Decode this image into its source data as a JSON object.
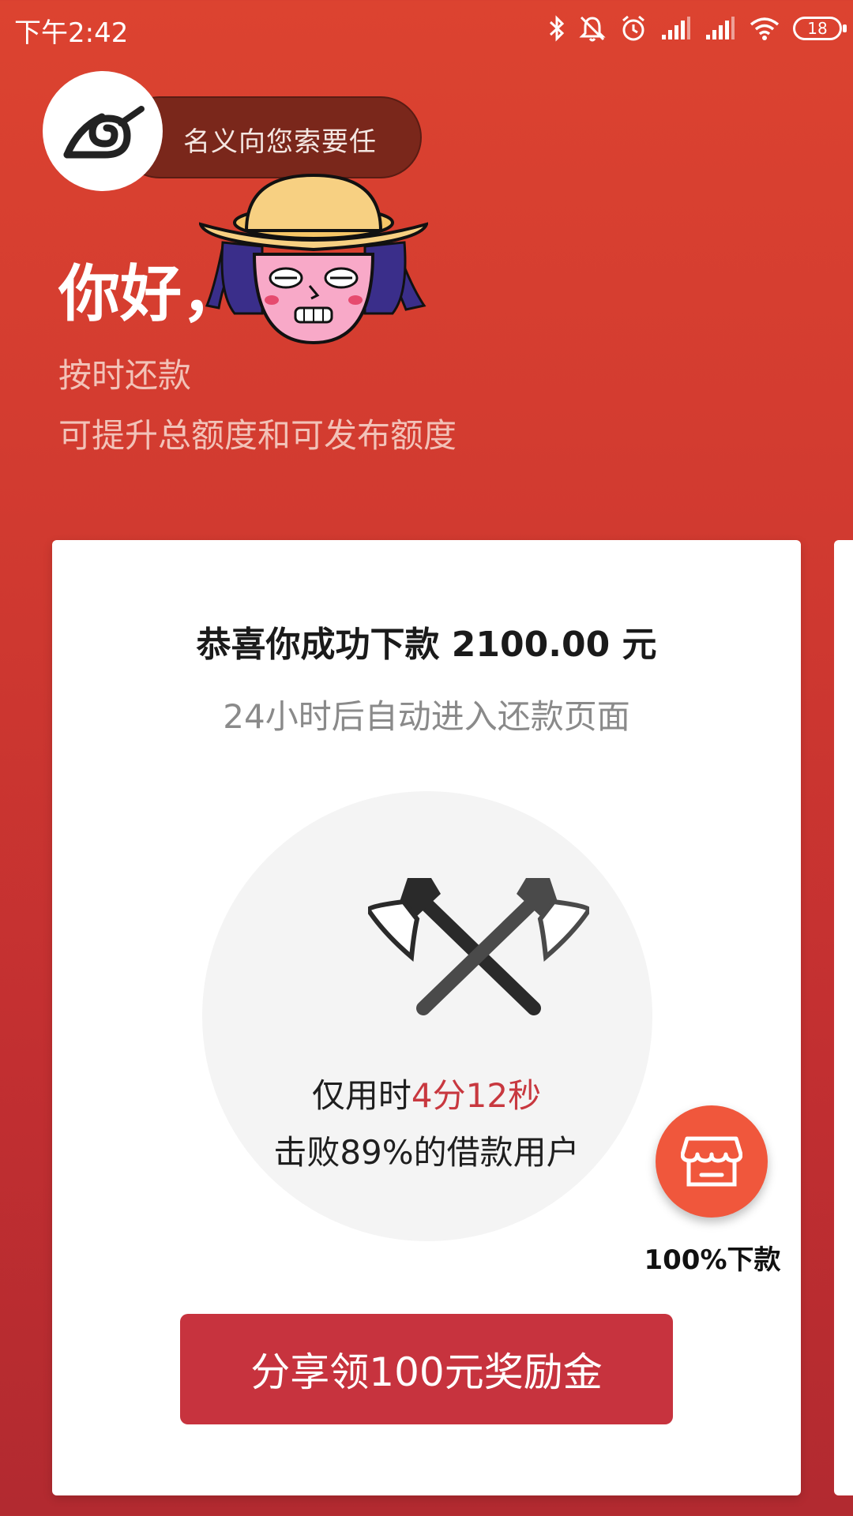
{
  "status_bar": {
    "time": "下午2:42",
    "battery": "18",
    "icons": [
      "bluetooth-icon",
      "mute-icon",
      "alarm-icon",
      "signal-icon",
      "signal-icon",
      "wifi-icon",
      "battery-icon"
    ]
  },
  "header": {
    "notice_text": "名义向您索要任",
    "greeting": "你好，",
    "line1": "按时还款",
    "line2": "可提升总额度和可发布额度"
  },
  "card": {
    "title": "恭喜你成功下款 2100.00 元",
    "subtitle": "24小时后自动进入还款页面",
    "time_prefix": "仅用时",
    "time_value": "4分12秒",
    "beat_text": "击败89%的借款用户",
    "share_button": "分享领100元奖励金"
  },
  "fab": {
    "label": "100%下款",
    "icon": "store-icon"
  },
  "colors": {
    "background_top": "#dc4330",
    "background_bottom": "#b22a30",
    "button": "#c7333e",
    "highlight": "#c8383f",
    "fab": "#f0573c"
  }
}
